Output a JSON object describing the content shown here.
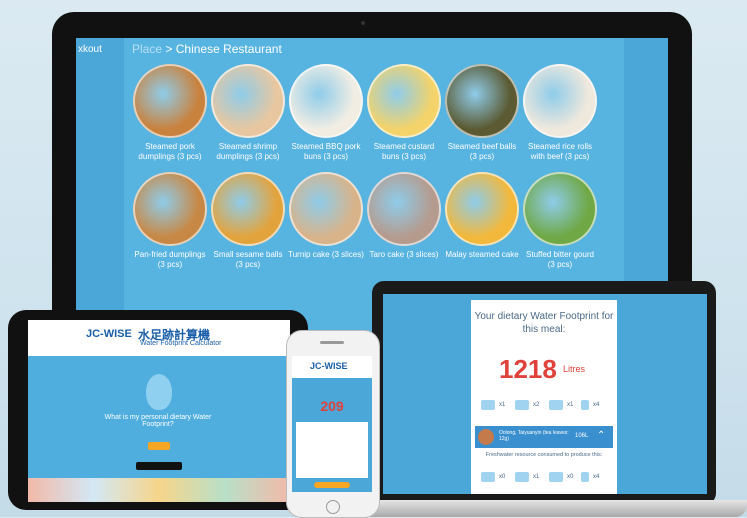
{
  "monitor": {
    "side_label": "xkout",
    "breadcrumb": {
      "root": "Place",
      "separator": ">",
      "current": "Chinese Restaurant"
    },
    "foods": [
      {
        "label": "Steamed pork dumplings (3 pcs)",
        "color": "#c9823e"
      },
      {
        "label": "Steamed shrimp dumplings (3 pcs)",
        "color": "#e8c7a0"
      },
      {
        "label": "Steamed BBQ pork buns (3 pcs)",
        "color": "#f1ede3"
      },
      {
        "label": "Steamed custard buns (3 pcs)",
        "color": "#f3d36a"
      },
      {
        "label": "Steamed beef balls (3 pcs)",
        "color": "#5b5a32"
      },
      {
        "label": "Steamed rice rolls with beef (3 pcs)",
        "color": "#efe8dc"
      },
      {
        "label": "Pan-fried dumplings (3 pcs)",
        "color": "#c88845"
      },
      {
        "label": "Small sesame balls (3 pcs)",
        "color": "#e3a33c"
      },
      {
        "label": "Turnip cake (3 slices)",
        "color": "#d8b38a"
      },
      {
        "label": "Taro cake (3 slices)",
        "color": "#b59b8e"
      },
      {
        "label": "Malay steamed cake",
        "color": "#f2b83b"
      },
      {
        "label": "Stuffed bitter gourd (3 pcs)",
        "color": "#6fa845"
      }
    ]
  },
  "tablet": {
    "logo": "JC-WISE",
    "title_cn": "水足跡計算機",
    "subtitle": "Water Footprint Calculator",
    "question": "What is my personal dietary Water Footprint?"
  },
  "phone": {
    "logo": "JC-WISE",
    "number": "209"
  },
  "laptop": {
    "title": "Your dietary Water Footprint for this meal:",
    "number": "1218",
    "unit": "Litres",
    "multipliers": [
      "x1",
      "x2",
      "x1",
      "x4"
    ],
    "meal_name": "Oolong, Taiyuanyin (tea leaves: 12g)",
    "meal_value": "106L",
    "freshwater_text": "Freshwater resource consumed to produce this:",
    "bottom_multipliers": [
      "x0",
      "x1",
      "x0",
      "x4"
    ]
  }
}
